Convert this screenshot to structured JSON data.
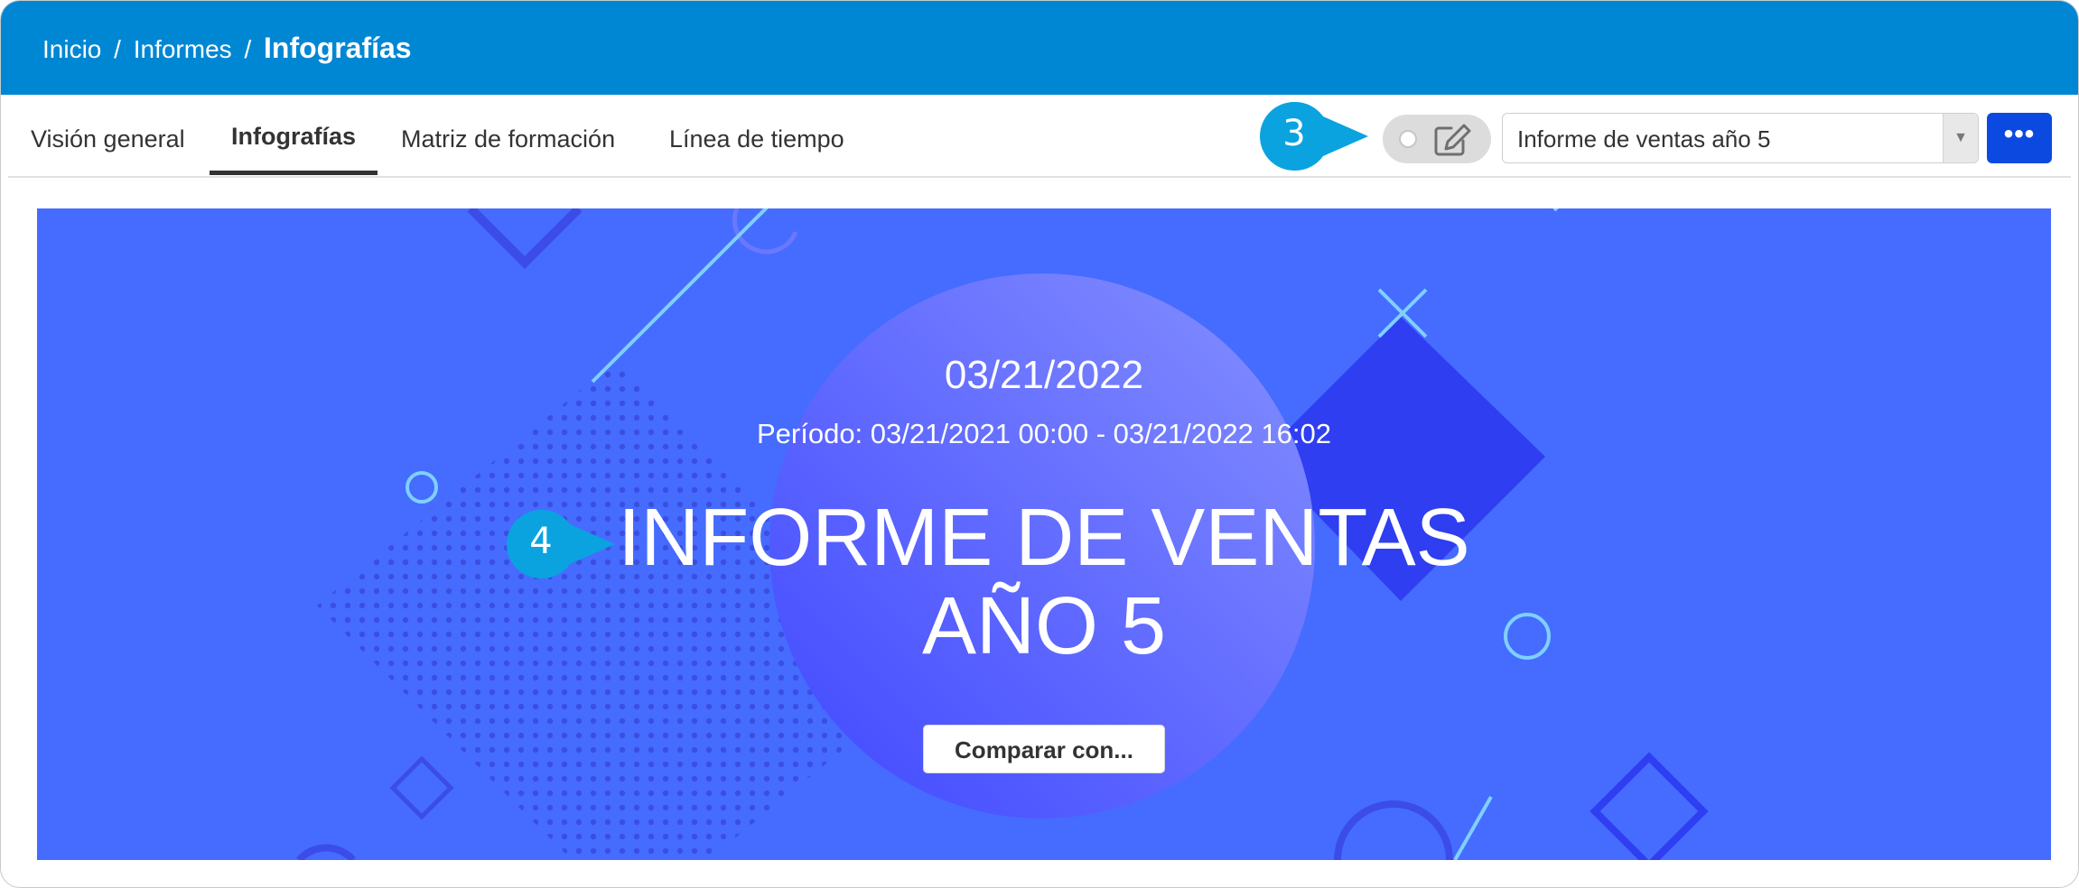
{
  "breadcrumb": {
    "items": [
      "Inicio",
      "Informes"
    ],
    "separator": "/",
    "current": "Infografías"
  },
  "tabs": [
    {
      "label": "Visión general",
      "active": false
    },
    {
      "label": "Infografías",
      "active": true
    },
    {
      "label": "Matriz de formación",
      "active": false
    },
    {
      "label": "Línea de tiempo",
      "active": false
    }
  ],
  "toolbar": {
    "edit_toggle_icon": "pencil-square-icon",
    "report_select_value": "Informe de ventas año 5",
    "dropdown_arrow": "▼",
    "more_button_label": "•••"
  },
  "callouts": {
    "callout_3": "3",
    "callout_4": "4"
  },
  "banner": {
    "date": "03/21/2022",
    "period": "Período: 03/21/2021 00:00 - 03/21/2022 16:02",
    "title_line1": "INFORME DE VENTAS",
    "title_line2": "AÑO 5",
    "compare_button": "Comparar con..."
  },
  "colors": {
    "header": "#0087d4",
    "callout": "#0aa3e0",
    "banner": "#456cff",
    "primary_button": "#0b49e0"
  }
}
